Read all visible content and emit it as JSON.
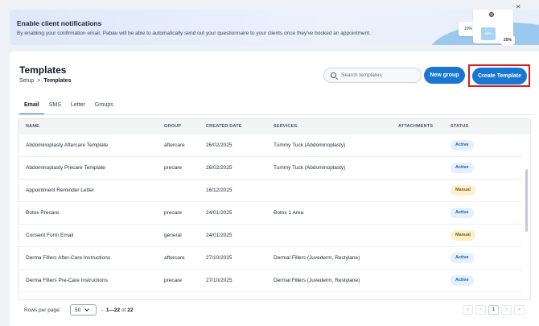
{
  "banner": {
    "title": "Enable client notifications",
    "text": "By enabling your confirmation email, Pabau will be able to automatically send out your questionnaire to your clients once they've booked an appointment.",
    "stat1": "10%",
    "stat2": "50%",
    "stat3": "25%",
    "close_icon": "close-icon"
  },
  "header": {
    "title": "Templates",
    "breadcrumb": {
      "parent": "Setup",
      "separator": ">",
      "current": "Templates"
    }
  },
  "search": {
    "placeholder": "Search templates",
    "value": ""
  },
  "buttons": {
    "new_group": "New group",
    "create_template": "Create Template"
  },
  "tabs": [
    {
      "label": "Email",
      "active": true
    },
    {
      "label": "SMS",
      "active": false
    },
    {
      "label": "Letter",
      "active": false
    },
    {
      "label": "Groups",
      "active": false
    }
  ],
  "table": {
    "columns": [
      "NAME",
      "GROUP",
      "CREATED DATE",
      "SERVICES",
      "ATTACHMENTS",
      "STATUS"
    ],
    "rows": [
      {
        "name": "Abdominoplasty Aftercare Template",
        "group": "aftercare",
        "created": "26/02/2025",
        "services": "Tummy Tuck (Abdominoplasty)",
        "attachments": "",
        "status": "Active"
      },
      {
        "name": "Abdominoplasty Precare Template",
        "group": "precare",
        "created": "26/02/2025",
        "services": "Tummy Tuck (Abdominoplasty)",
        "attachments": "",
        "status": "Active"
      },
      {
        "name": "Appointment Reminder Letter",
        "group": "",
        "created": "16/12/2025",
        "services": "",
        "attachments": "",
        "status": "Manual"
      },
      {
        "name": "Botox Precare",
        "group": "precare",
        "created": "24/01/2025",
        "services": "Botox 1 Area",
        "attachments": "",
        "status": "Active"
      },
      {
        "name": "Consent Form Email",
        "group": "general",
        "created": "24/01/2025",
        "services": "",
        "attachments": "",
        "status": "Manual"
      },
      {
        "name": "Derma Fillers After-Care Instructions",
        "group": "aftercare",
        "created": "27/10/2025",
        "services": "Dermal Fillers (Juvederm, Restylane)",
        "attachments": "",
        "status": "Active"
      },
      {
        "name": "Derma Fillers Pre-Care Instructions",
        "group": "precare",
        "created": "27/10/2025",
        "services": "Dermal Fillers (Juvederm, Restylane)",
        "attachments": "",
        "status": "Active"
      }
    ]
  },
  "footer": {
    "rows_per_page_label": "Rows per page:",
    "rows_per_page": "50",
    "range_sep": "-",
    "range": "1—22",
    "of": "of",
    "total": "22",
    "pages": [
      "«",
      "‹",
      "1",
      "›",
      "»"
    ],
    "current_page": "1"
  },
  "colors": {
    "accent": "#1877d2",
    "highlight": "#d91c1c",
    "active_badge": "#e4f0fb",
    "manual_badge": "#fcf1cf"
  }
}
